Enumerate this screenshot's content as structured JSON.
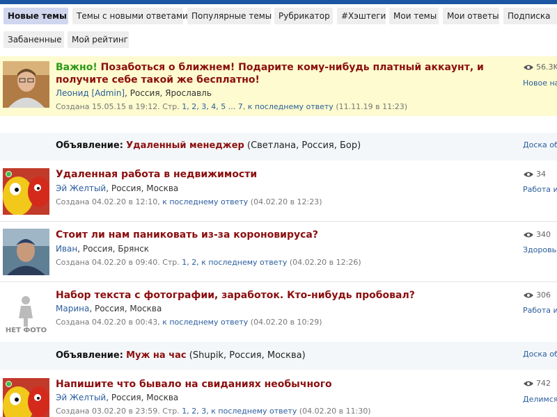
{
  "tabs": [
    {
      "label": "Новые темы",
      "active": true
    },
    {
      "label": "Темы с новыми ответами"
    },
    {
      "label": "Популярные темы"
    },
    {
      "label": "Рубрикатор"
    },
    {
      "label": "#Хэштеги"
    },
    {
      "label": "Мои темы"
    },
    {
      "label": "Мои ответы"
    },
    {
      "label": "Подписка"
    },
    {
      "label": "Забаненные"
    },
    {
      "label": "Мой рейтинг"
    }
  ],
  "topics": [
    {
      "important_label": "Важно!",
      "title": "Позаботься о ближнем! Подарите кому-нибудь платный аккаунт, и получите себе такой же бесплатно!",
      "author": "Леонид [Admin]",
      "location": ", Россия, Ярославль",
      "created": "Создана 15.05.15 в 19:12.",
      "pages_label": "Стр.",
      "pages": "1, 2, 3, 4, 5 ... 7",
      "last_link": "к последнему ответу",
      "last_date": "(11.11.19 в 11:23)",
      "views": "56.3K",
      "category": "Новое на"
    },
    {
      "title": "Удаленная работа в недвижимости",
      "author": "Эй Желтый",
      "location": ", Россия, Москва",
      "created": "Создана 04.02.20 в 12:10,",
      "last_link": "к последнему ответу",
      "last_date": "(04.02.20 в 12:23)",
      "views": "34",
      "category": "Работа и"
    },
    {
      "title": "Стоит ли нам паниковать из-за короновируса?",
      "author": "Иван",
      "location": ", Россия, Брянск",
      "created": "Создана 04.02.20 в 09:40.",
      "pages_label": "Стр.",
      "pages": "1, 2,",
      "last_link": "к последнему ответу",
      "last_date": "(04.02.20 в 12:26)",
      "views": "340",
      "category": "Здоровье"
    },
    {
      "title": "Набор текста с фотографии, заработок. Кто-нибудь пробовал?",
      "author": "Марина",
      "location": ", Россия, Москва",
      "created": "Создана 04.02.20 в 00:43,",
      "last_link": "к последнему ответу",
      "last_date": "(04.02.20 в 10:29)",
      "views": "306",
      "category": "Работа и",
      "avatar_text": "НЕТ ФОТО"
    },
    {
      "title": "Напишите что бывало на свиданиях необычного",
      "author": "Эй Желтый",
      "location": ", Россия, Москва",
      "created": "Создана 03.02.20 в 23:59.",
      "pages_label": "Стр.",
      "pages": "1, 2, 3,",
      "last_link": "к последнему ответу",
      "last_date": "(04.02.20 в 11:30)",
      "views": "742",
      "category": "Делимся"
    }
  ],
  "ads": [
    {
      "label": "Объявление:",
      "title": "Удаленный менеджер",
      "details": "(Светлана, Россия, Бор)",
      "category": "Доска об"
    },
    {
      "label": "Объявление:",
      "title": "Муж на час",
      "details": "(Shupik, Россия, Москва)",
      "category": "Доска об"
    }
  ],
  "colors": {
    "accent": "#1a56a3",
    "title": "#8b0f0f",
    "important": "#2e9a1a",
    "link": "#2a5d9c",
    "highlight_bg": "#fdfbcf"
  }
}
